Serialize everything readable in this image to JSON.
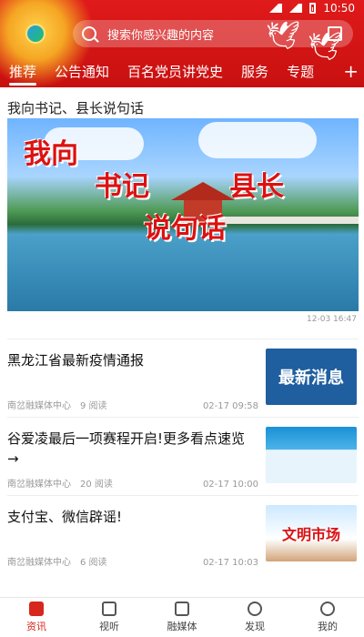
{
  "status": {
    "time": "10:50"
  },
  "search": {
    "placeholder": "搜索你感兴趣的内容"
  },
  "tabs": [
    {
      "label": "推荐",
      "active": true
    },
    {
      "label": "公告通知"
    },
    {
      "label": "百名党员讲党史"
    },
    {
      "label": "服务"
    },
    {
      "label": "专题"
    }
  ],
  "feature": {
    "section_title": "我向书记、县长说句话",
    "calligraphy": [
      "我向",
      "书记",
      "县长",
      "说句话"
    ],
    "time": "12-03 16:47"
  },
  "news": [
    {
      "title": "黑龙江省最新疫情通报",
      "source": "南岔融媒体中心",
      "reads": "9 阅读",
      "time": "02-17 09:58",
      "thumb_text": "最新消息"
    },
    {
      "title": "谷爱凌最后一项赛程开启!更多看点速览→",
      "source": "南岔融媒体中心",
      "reads": "20 阅读",
      "time": "02-17 10:00"
    },
    {
      "title": "支付宝、微信辟谣!",
      "source": "南岔融媒体中心",
      "reads": "6 阅读",
      "time": "02-17 10:03",
      "thumb_text": "文明市场"
    }
  ],
  "bottom_nav": [
    {
      "label": "资讯",
      "icon": "document-icon",
      "active": true
    },
    {
      "label": "视听",
      "icon": "video-icon"
    },
    {
      "label": "融媒体",
      "icon": "store-icon"
    },
    {
      "label": "发现",
      "icon": "compass-icon"
    },
    {
      "label": "我的",
      "icon": "user-icon"
    }
  ],
  "colors": {
    "brand_red": "#d7261b"
  }
}
